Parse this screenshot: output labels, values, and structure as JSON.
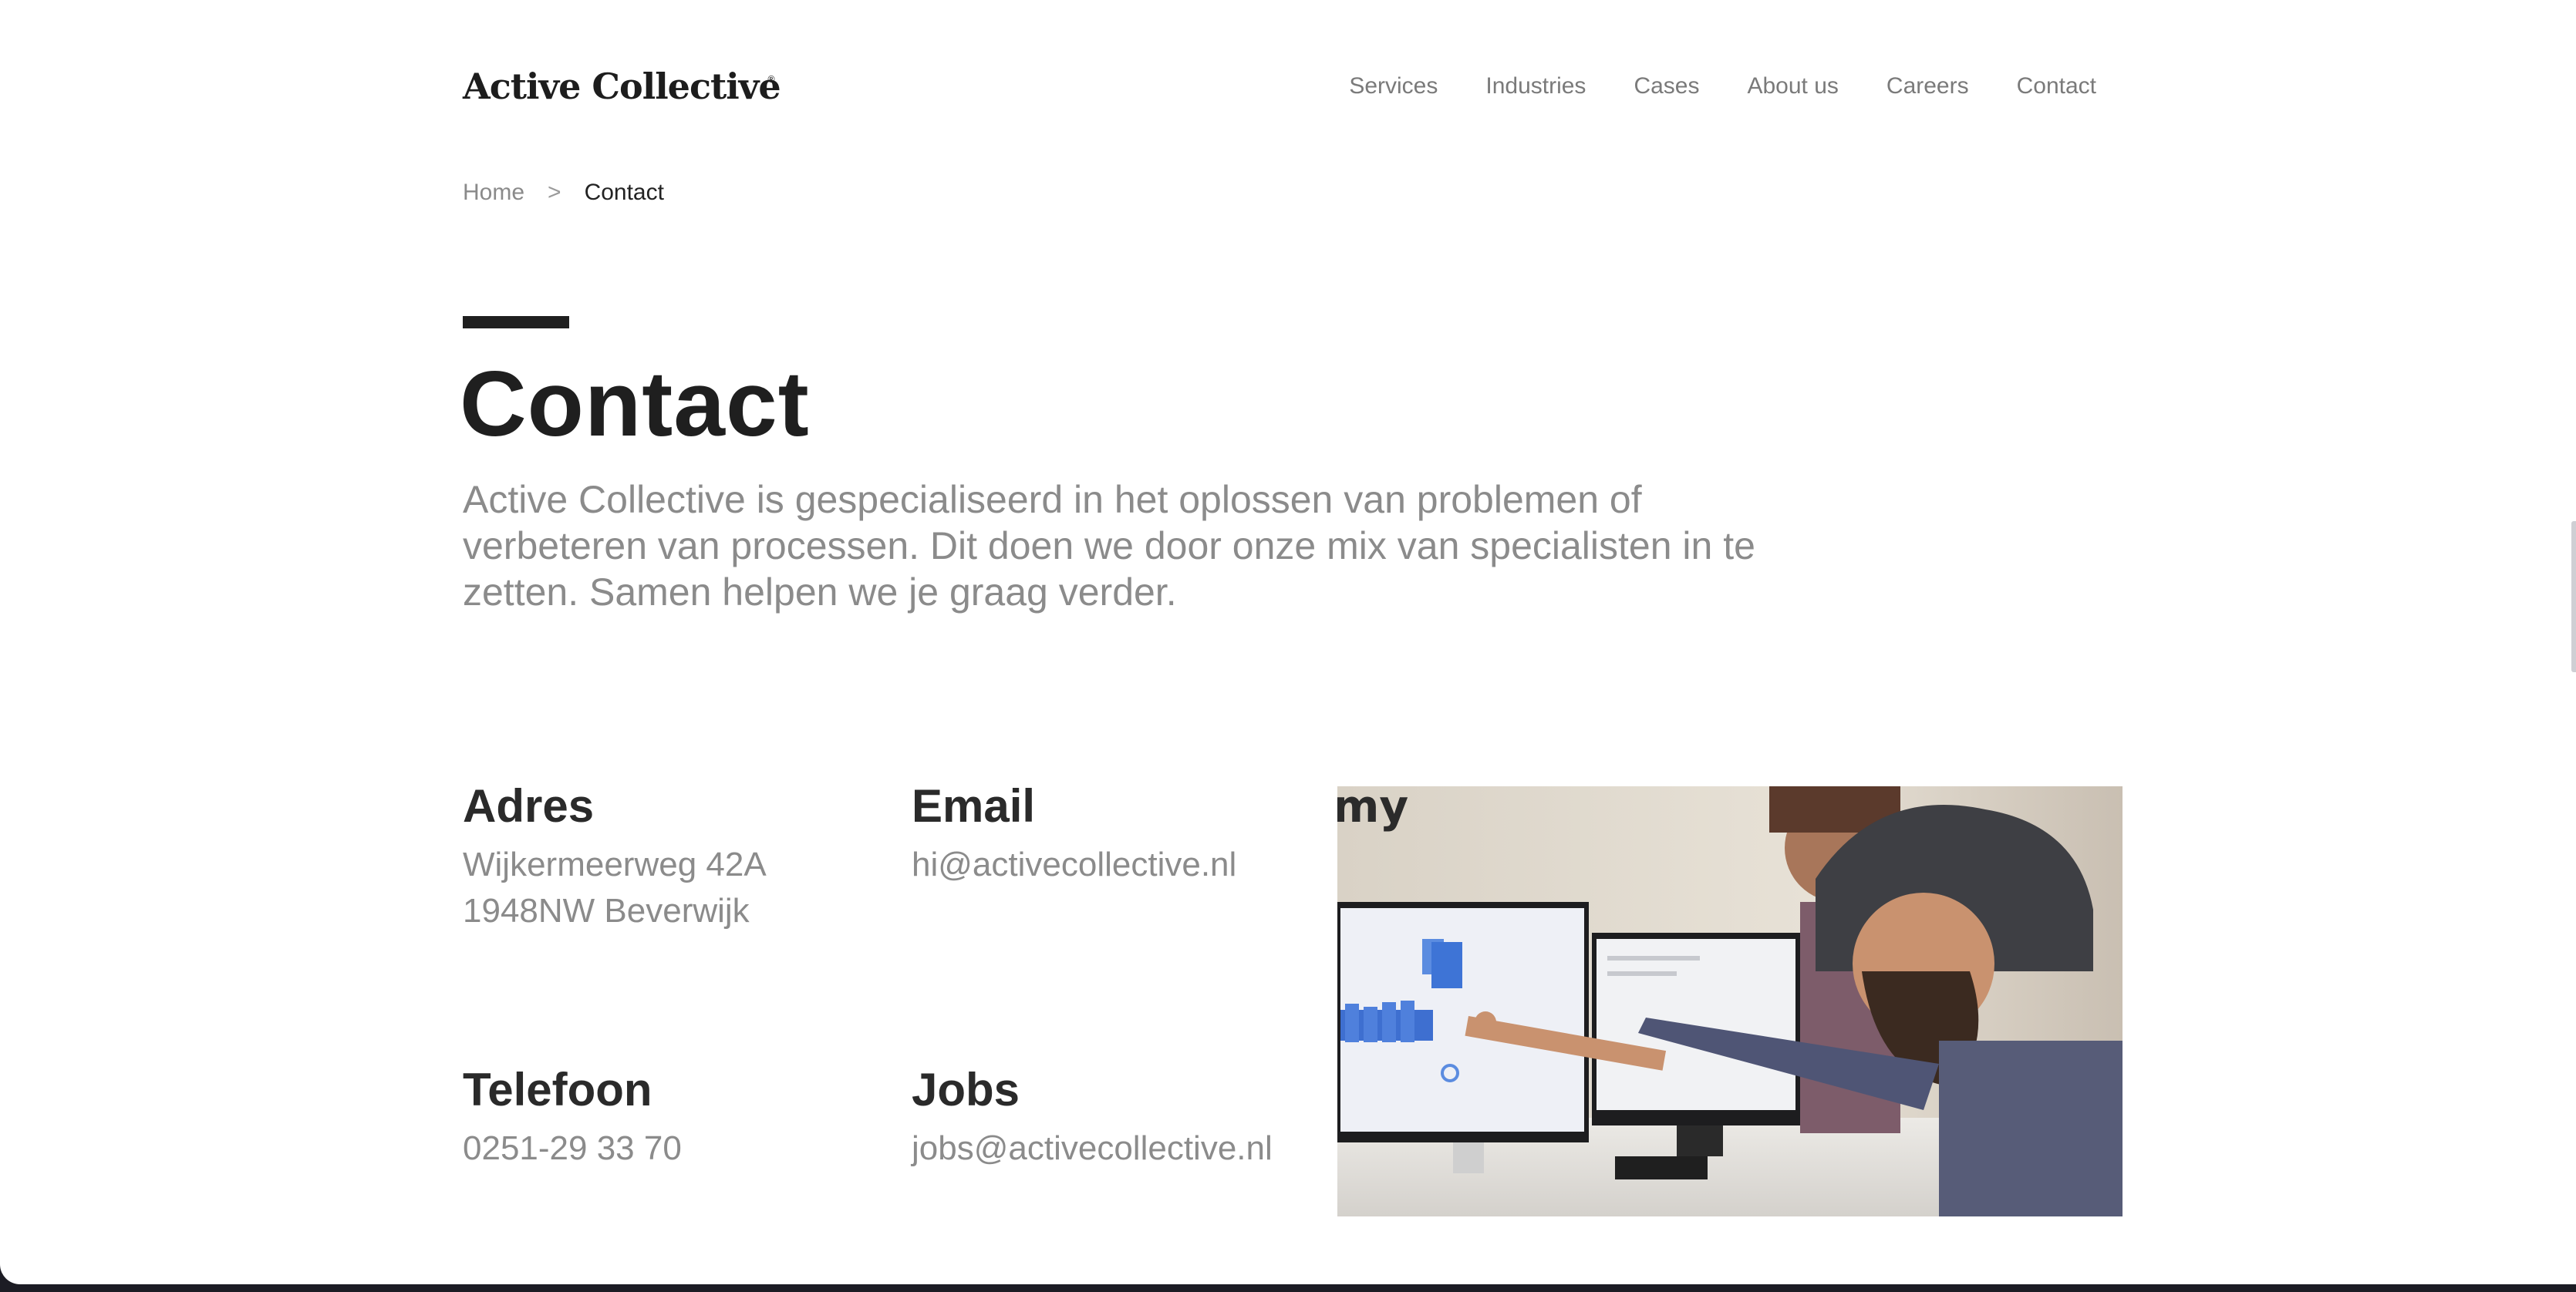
{
  "header": {
    "logo": "Active Collective",
    "logo_mark": "®",
    "nav": [
      "Services",
      "Industries",
      "Cases",
      "About us",
      "Careers",
      "Contact"
    ]
  },
  "breadcrumb": {
    "home": "Home",
    "separator": ">",
    "current": "Contact"
  },
  "main": {
    "title": "Contact",
    "intro": "Active Collective is gespecialiseerd in het oplossen van problemen of verbeteren van processen. Dit doen we door onze mix van specialisten in te zetten. Samen helpen we je graag verder."
  },
  "contact": {
    "adres": {
      "heading": "Adres",
      "line1": "Wijkermeerweg 42A",
      "line2": "1948NW Beverwijk"
    },
    "email": {
      "heading": "Email",
      "value": "hi@activecollective.nl"
    },
    "telefoon": {
      "heading": "Telefoon",
      "value": "0251-29 33 70"
    },
    "jobs": {
      "heading": "Jobs",
      "value": "jobs@activecollective.nl"
    }
  },
  "colors": {
    "text_dark": "#1f1f1f",
    "text_muted": "#8b8b8b",
    "nav": "#7a7a7a",
    "background": "#ffffff"
  }
}
